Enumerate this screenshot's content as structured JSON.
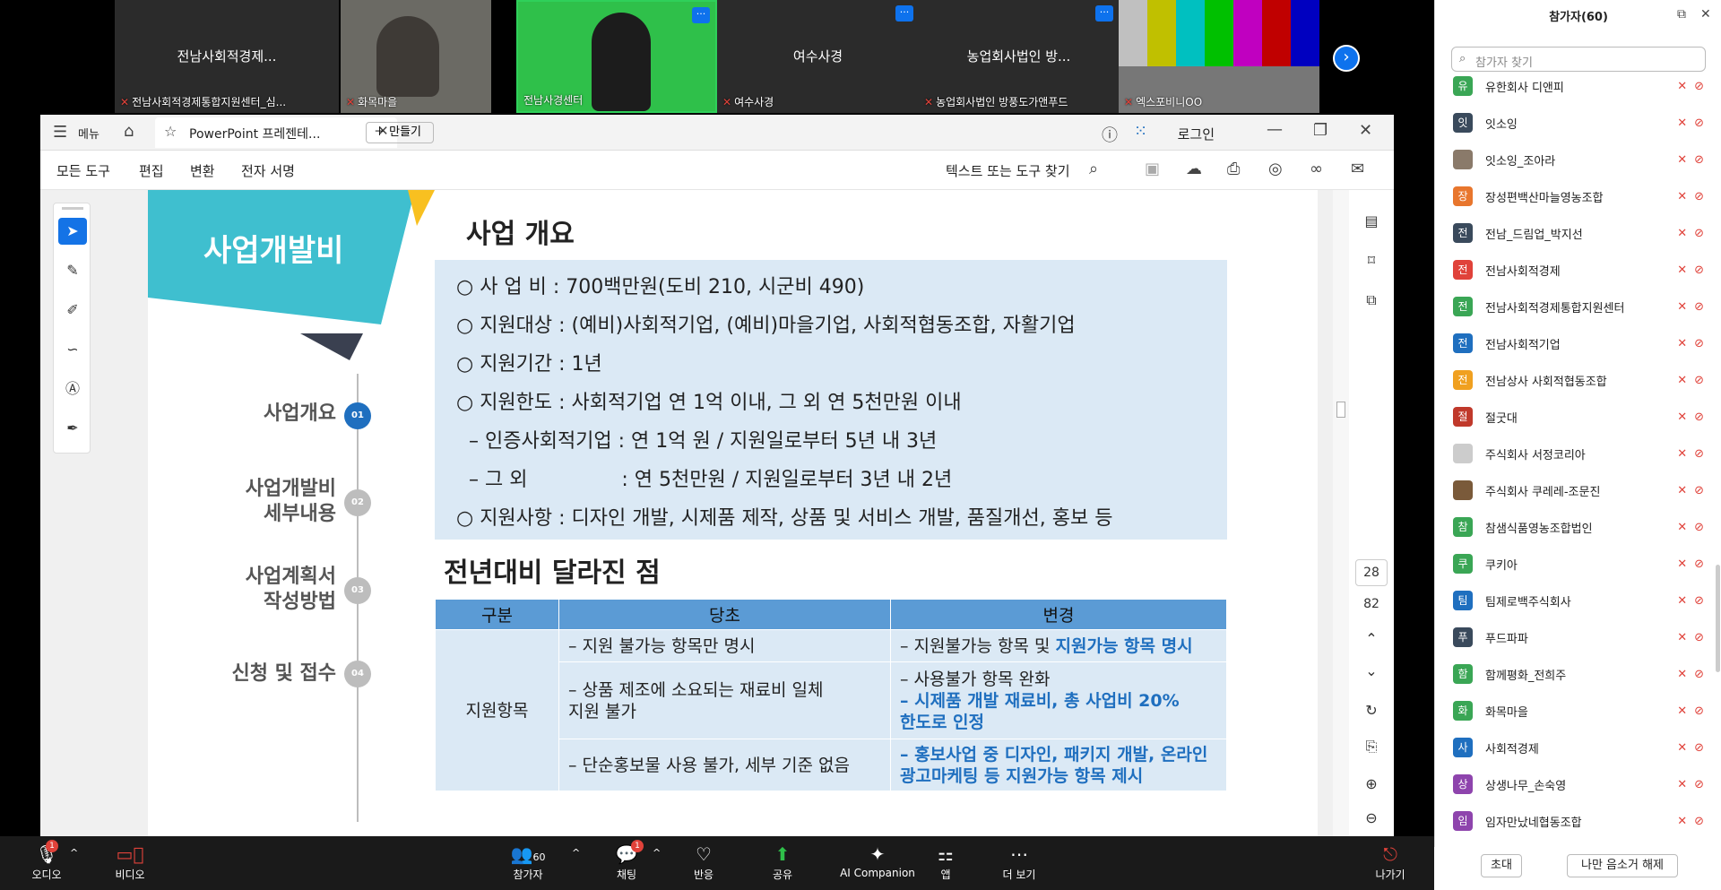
{
  "video_tiles": [
    {
      "name": "전남사회적경제...",
      "label": "전남사회적경제통합지원센터_심..."
    },
    {
      "name": "",
      "label": "화목마을"
    },
    {
      "name": "",
      "label": "전남사경센터"
    },
    {
      "name": "여수사경",
      "label": "여수사경"
    },
    {
      "name": "농업회사법인 방...",
      "label": "농업회사법인 방풍도가앤푸드"
    },
    {
      "name": "",
      "label": "엑스포비니OO"
    }
  ],
  "acrobat": {
    "menu": "메뉴",
    "tab_title": "PowerPoint 프레젠테...",
    "new_tab": "만들기",
    "login": "로그인",
    "toolbar": {
      "all_tools": "모든 도구",
      "edit": "편집",
      "convert": "변환",
      "esign": "전자 서명",
      "search_placeholder": "텍스트 또는 도구 찾기"
    },
    "page_number": "28",
    "page_total": "82"
  },
  "slide": {
    "section_title": "사업개발비",
    "overview_heading": "사업 개요",
    "overview_lines": [
      "○ 사 업 비  : 700백만원(도비 210, 시군비 490)",
      "○ 지원대상 : (예비)사회적기업, (예비)마을기업, 사회적협동조합, 자활기업",
      "○ 지원기간 : 1년",
      "○ 지원한도 : 사회적기업 연 1억 이내, 그 외 연 5천만원 이내",
      "  – 인증사회적기업 : 연 1억 원 / 지원일로부터 5년 내 3년",
      "  – 그 외               : 연 5천만원 / 지원일로부터 3년 내 2년",
      "○ 지원사항 : 디자인 개발, 시제품 제작, 상품 및 서비스 개발, 품질개선, 홍보 등"
    ],
    "nav": [
      {
        "label": "사업개요",
        "num": "01"
      },
      {
        "label": "사업개발비\n세부내용",
        "num": "02"
      },
      {
        "label": "사업계획서\n작성방법",
        "num": "03"
      },
      {
        "label": "신청 및 접수",
        "num": "04"
      }
    ],
    "diff_heading": "전년대비 달라진 점",
    "table": {
      "headers": [
        "구분",
        "당초",
        "변경"
      ],
      "category": "지원항목",
      "rows": [
        {
          "before": "– 지원 불가능 항목만 명시",
          "after_plain": "– 지원불가능 항목 및 ",
          "after_blue": "지원가능 항목 명시"
        },
        {
          "before": "– 상품 제조에 소요되는 재료비 일체\n   지원 불가",
          "after_plain": "– 사용불가 항목 완화",
          "after_blue": "– 시제품 개발 재료비, 총 사업비 20%\n   한도로 인정"
        },
        {
          "before": "– 단순홍보물 사용 불가, 세부 기준 없음",
          "after_plain": "",
          "after_blue": "– 홍보사업 중 디자인, 패키지 개발, 온라인\n   광고마케팅 등 지원가능 항목 제시"
        }
      ]
    }
  },
  "participants": {
    "title": "참가자(60)",
    "search_placeholder": "참가자 찾기",
    "list": [
      {
        "initial": "유",
        "name": "유한회사 디앤피",
        "color": "#3aa655"
      },
      {
        "initial": "잇",
        "name": "잇소잉",
        "color": "#3a4a5c"
      },
      {
        "initial": "",
        "name": "잇소잉_조아라",
        "color": "#8a7a6a"
      },
      {
        "initial": "장",
        "name": "장성편백산마늘영농조합",
        "color": "#e8762d"
      },
      {
        "initial": "전",
        "name": "전남_드림업_박지선",
        "color": "#3a4a5c"
      },
      {
        "initial": "전",
        "name": "전남사회적경제",
        "color": "#e0423a"
      },
      {
        "initial": "전",
        "name": "전남사회적경제통합지원센터",
        "color": "#3aa655"
      },
      {
        "initial": "전",
        "name": "전남사회적기업",
        "color": "#1f6fbf"
      },
      {
        "initial": "전",
        "name": "전남상사 사회적협동조합",
        "color": "#f0a020"
      },
      {
        "initial": "절",
        "name": "절굿대",
        "color": "#c0392b"
      },
      {
        "initial": "",
        "name": "주식회사 서정코리아",
        "color": "#cccccc"
      },
      {
        "initial": "",
        "name": "주식회사 쿠레레-조문진",
        "color": "#7a5a3a"
      },
      {
        "initial": "참",
        "name": "참샘식품영농조합법인",
        "color": "#3aa655"
      },
      {
        "initial": "쿠",
        "name": "쿠키아",
        "color": "#3aa655"
      },
      {
        "initial": "팀",
        "name": "팀제로백주식회사",
        "color": "#1f6fbf"
      },
      {
        "initial": "푸",
        "name": "푸드파파",
        "color": "#3a4a5c"
      },
      {
        "initial": "함",
        "name": "함께평화_전희주",
        "color": "#3aa655"
      },
      {
        "initial": "화",
        "name": "화목마을",
        "color": "#3aa655"
      },
      {
        "initial": "사",
        "name": "사회적경제",
        "color": "#1f6fbf"
      },
      {
        "initial": "상",
        "name": "상생나무_손숙영",
        "color": "#8e44ad"
      },
      {
        "initial": "임",
        "name": "임자만났네협동조합",
        "color": "#8e44ad"
      }
    ],
    "invite": "초대",
    "unmute_me": "나만 음소거 해제"
  },
  "controls": {
    "audio": "오디오",
    "video": "비디오",
    "participants": "참가자",
    "participants_count": "60",
    "chat": "채팅",
    "chat_badge": "1",
    "audio_badge": "1",
    "reactions": "반응",
    "share": "공유",
    "ai": "AI Companion",
    "apps": "앱",
    "more": "더 보기",
    "leave": "나가기"
  }
}
